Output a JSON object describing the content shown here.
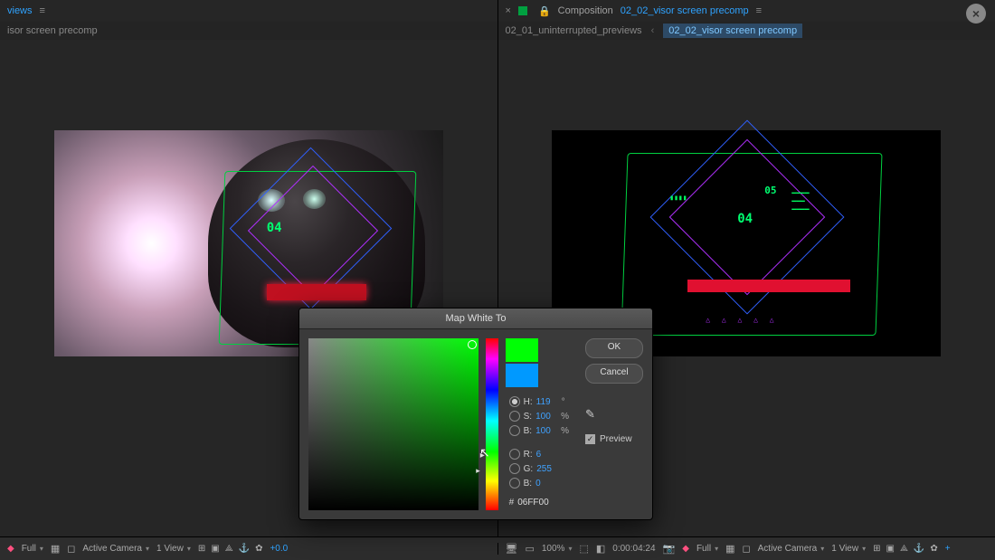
{
  "left_pane": {
    "tab_label": "views",
    "subtitle": "isor screen precomp"
  },
  "right_pane": {
    "tab_prefix": "Composition",
    "tab_comp": "02_02_visor screen precomp",
    "crumb_parent": "02_01_uninterrupted_previews",
    "crumb_active": "02_02_visor screen precomp"
  },
  "hud": {
    "num1": "04",
    "num2": "05"
  },
  "dialog": {
    "title": "Map White To",
    "ok": "OK",
    "cancel": "Cancel",
    "preview_label": "Preview",
    "fields": {
      "H": {
        "label": "H:",
        "value": "119",
        "unit": "°"
      },
      "S": {
        "label": "S:",
        "value": "100",
        "unit": "%"
      },
      "B": {
        "label": "B:",
        "value": "100",
        "unit": "%"
      },
      "R": {
        "label": "R:",
        "value": "6",
        "unit": ""
      },
      "G": {
        "label": "G:",
        "value": "255",
        "unit": ""
      },
      "Bl": {
        "label": "B:",
        "value": "0",
        "unit": ""
      }
    },
    "hex_prefix": "#",
    "hex": "06FF00"
  },
  "footer": {
    "left": {
      "quality": "Full",
      "camera": "Active Camera",
      "views": "1 View",
      "exposure": "+0.0"
    },
    "right": {
      "zoom": "100%",
      "time": "0:00:04:24",
      "quality": "Full",
      "camera": "Active Camera",
      "views": "1 View"
    }
  }
}
